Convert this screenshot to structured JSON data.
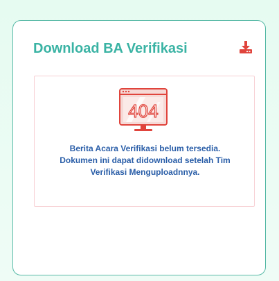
{
  "card": {
    "title": "Download BA Verifikasi",
    "download_icon": "download-icon"
  },
  "notice": {
    "illustration_icon": "error-404-icon",
    "illustration_text": "404",
    "lines": [
      "Berita Acara Verifikasi belum tersedia.",
      "Dokumen ini dapat didownload setelah Tim",
      "Verifikasi Menguploadnnya."
    ]
  },
  "colors": {
    "title": "#3ab3a4",
    "accent_red": "#e0443c",
    "notice_text": "#2a5ea8",
    "card_border": "#56b9a6",
    "notice_border": "#f7cfd3"
  }
}
